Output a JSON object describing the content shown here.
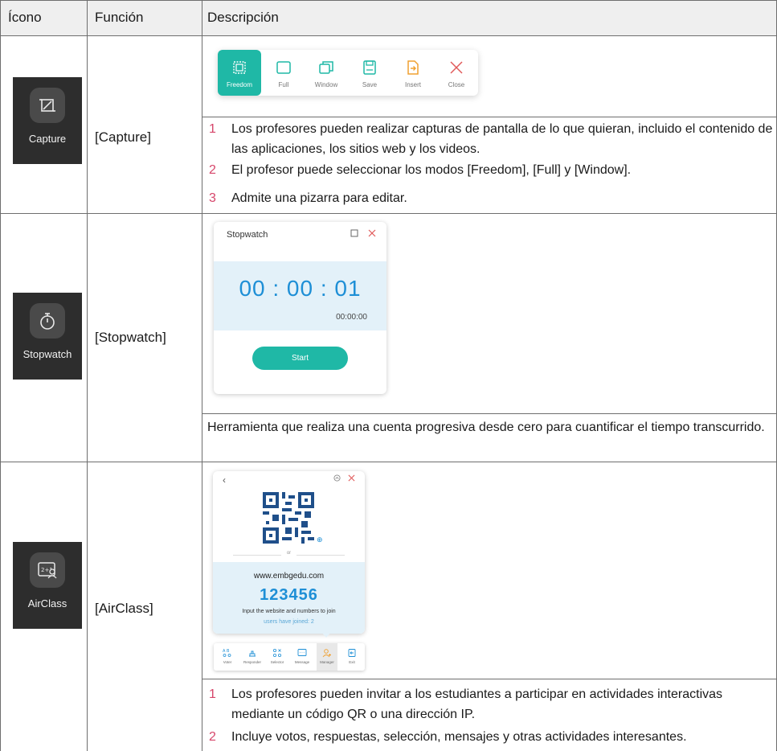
{
  "header": {
    "col_icon": "Ícono",
    "col_function": "Función",
    "col_description": "Descripción"
  },
  "rows": [
    {
      "icon_label": "Capture",
      "function": "[Capture]",
      "toolbar": [
        "Freedom",
        "Full",
        "Window",
        "Save",
        "Insert",
        "Close"
      ],
      "items": [
        {
          "num": "1",
          "text": "Los profesores pueden realizar capturas de pantalla de lo que quieran, incluido el contenido de las aplicaciones, los sitios web y los videos."
        },
        {
          "num": "2",
          "text": "El profesor puede seleccionar los modos [Freedom], [Full] y [Window]."
        },
        {
          "num": "3",
          "text": "Admite una pizarra para editar."
        }
      ]
    },
    {
      "icon_label": "Stopwatch",
      "function": "[Stopwatch]",
      "window_title": "Stopwatch",
      "time": "00 : 00 : 01",
      "subtime": "00:00:00",
      "start_label": "Start",
      "description": "Herramienta que realiza una cuenta progresiva desde cero para cuantificar el tiempo transcurrido."
    },
    {
      "icon_label": "AirClass",
      "function": "[AirClass]",
      "or_text": "or",
      "url": "www.embgedu.com",
      "code": "123456",
      "instruction": "Input the website and numbers to join",
      "joined": "users have joined: 2",
      "tools": [
        "Voter",
        "Responder",
        "Selector",
        "Message",
        "Manager",
        "Exit"
      ],
      "items": [
        {
          "num": "1",
          "text": "Los profesores pueden invitar a los estudiantes a participar en actividades interactivas mediante un código QR o una dirección IP."
        },
        {
          "num": "2",
          "text": "Incluye votos, respuestas, selección, mensajes y otras actividades interesantes."
        }
      ]
    }
  ],
  "colors": {
    "accent_teal": "#1fb8a6",
    "accent_blue": "#1e8fd6",
    "number_pink": "#d6456a",
    "insert_orange": "#f0a030",
    "close_red": "#e05a5a"
  }
}
